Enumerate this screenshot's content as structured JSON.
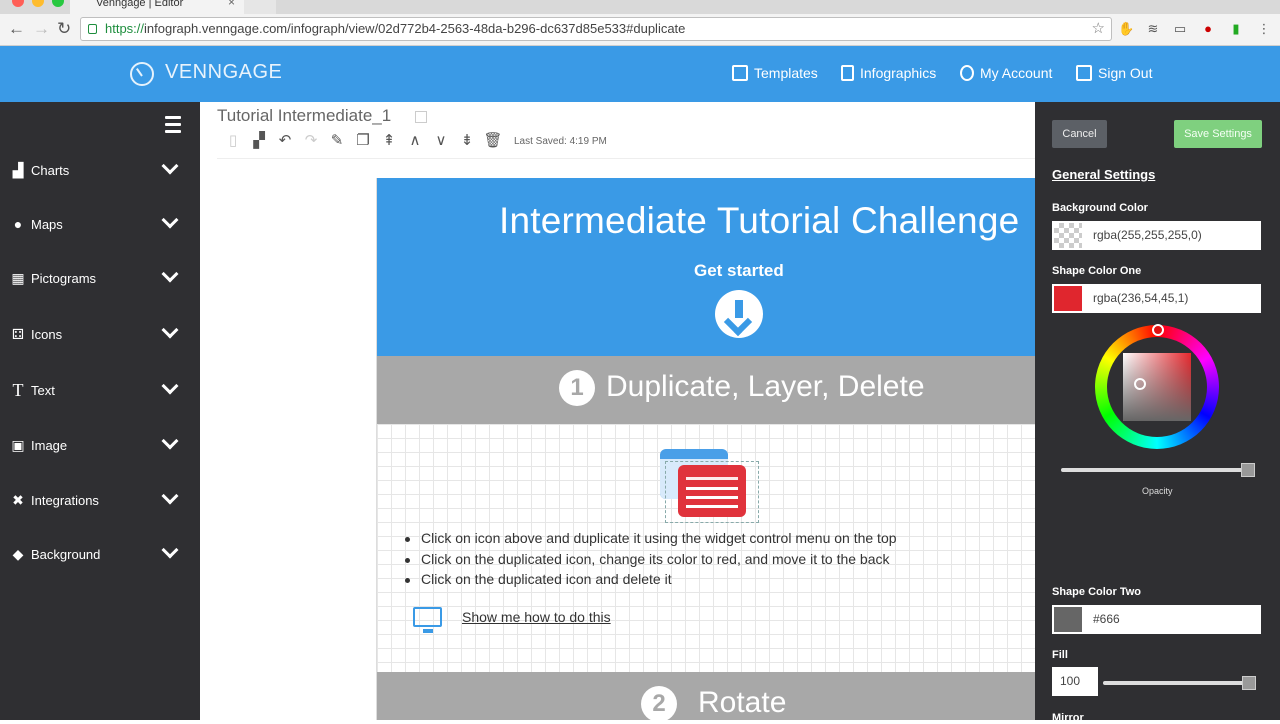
{
  "browser": {
    "tab_title": "Venngage | Editor",
    "url_scheme": "https://",
    "url_rest": "infograph.venngage.com/infograph/view/02d772b4-2563-48da-b296-dc637d85e533#duplicate"
  },
  "header": {
    "logo": "VENNGAGE",
    "nav": [
      {
        "label": "Templates",
        "icon": "templates-icon"
      },
      {
        "label": "Infographics",
        "icon": "infographics-icon"
      },
      {
        "label": "My Account",
        "icon": "account-icon"
      },
      {
        "label": "Sign Out",
        "icon": "signout-icon"
      }
    ]
  },
  "sidebar": {
    "items": [
      {
        "label": "Charts",
        "icon": "chart-icon"
      },
      {
        "label": "Maps",
        "icon": "globe-icon"
      },
      {
        "label": "Pictograms",
        "icon": "pictogram-icon"
      },
      {
        "label": "Icons",
        "icon": "dice-icon"
      },
      {
        "label": "Text",
        "icon": "text-icon"
      },
      {
        "label": "Image",
        "icon": "image-icon"
      },
      {
        "label": "Integrations",
        "icon": "integrations-icon"
      },
      {
        "label": "Background",
        "icon": "diamond-icon"
      }
    ]
  },
  "editor": {
    "doc_title": "Tutorial Intermediate_1",
    "last_saved": "Last Saved: 4:19 PM"
  },
  "infographic": {
    "title": "Intermediate Tutorial Challenge",
    "subtitle": "Get started",
    "section1": {
      "number": "1",
      "title": "Duplicate, Layer, Delete"
    },
    "bullets": [
      "Click on icon above and duplicate it using the widget control menu on the top",
      "Click on the duplicated icon, change its color to red, and move it to the back",
      "Click on the duplicated icon and delete it"
    ],
    "show_me": "Show me how to do this",
    "section2": {
      "number": "2",
      "title": "Rotate"
    }
  },
  "settings": {
    "cancel": "Cancel",
    "save": "Save Settings",
    "title": "General Settings",
    "bg_label": "Background Color",
    "bg_value": "rgba(255,255,255,0)",
    "shape1_label": "Shape Color One",
    "shape1_value": "rgba(236,54,45,1)",
    "shape1_color": "#e0262e",
    "opacity_label": "Opacity",
    "opacity_value": 1.0,
    "shape2_label": "Shape Color Two",
    "shape2_value": "#666",
    "fill_label": "Fill",
    "fill_value": "100",
    "mirror_label": "Mirror"
  }
}
